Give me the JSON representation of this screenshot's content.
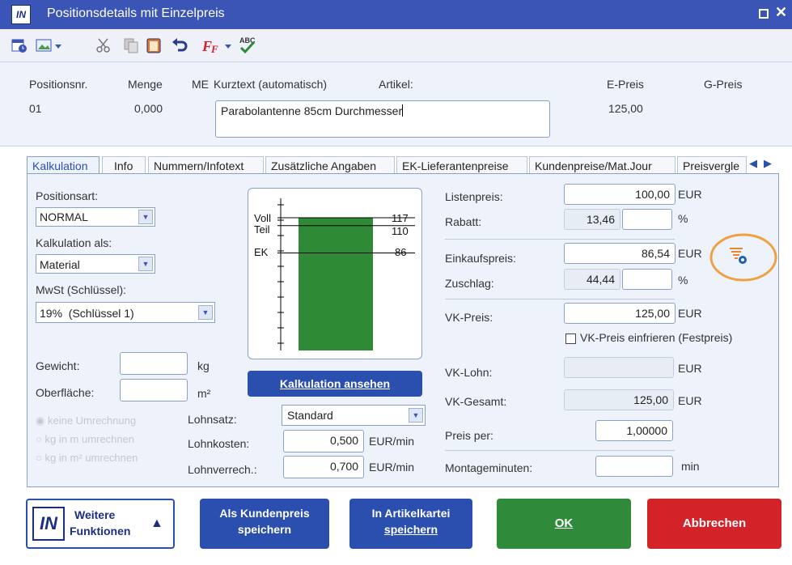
{
  "window": {
    "title": "Positionsdetails mit Einzelpreis",
    "logo": "IN"
  },
  "colors": {
    "titlebar": "#3a55b5",
    "accent": "#2b4fae",
    "ok": "#2f8a3a",
    "cancel": "#d32328",
    "bar": "#2f8a36",
    "highlight_circle": "#f0a040"
  },
  "toolbar": {
    "icons": [
      "calendar-clock-icon",
      "image-dropdown-icon",
      "cut-icon",
      "copy-icon",
      "paste-icon",
      "undo-icon",
      "font-dropdown-icon",
      "spellcheck-icon"
    ]
  },
  "header": {
    "col_posnr": "Positionsnr.",
    "col_menge": "Menge",
    "col_me": "ME",
    "col_kurztext": "Kurztext (automatisch)",
    "col_artikel": "Artikel:",
    "col_epreis": "E-Preis",
    "col_gpreis": "G-Preis",
    "posnr": "01",
    "menge": "0,000",
    "kurztext": "Parabolantenne 85cm Durchmesser",
    "epreis": "125,00"
  },
  "tabs": [
    "Kalkulation",
    "Info",
    "Nummern/Infotext",
    "Zusätzliche Angaben",
    "EK-Lieferantenpreise",
    "Kundenpreise/Mat.Jour",
    "Preisvergle"
  ],
  "left": {
    "positionsart_label": "Positionsart:",
    "positionsart_value": "NORMAL",
    "kalkulation_als_label": "Kalkulation als:",
    "kalkulation_als_value": "Material",
    "mwst_label": "MwSt (Schlüssel):",
    "mwst_value": "19%  (Schlüssel 1)",
    "gewicht_label": "Gewicht:",
    "gewicht_unit": "kg",
    "oberflaeche_label": "Oberfläche:",
    "oberflaeche_unit": "m²",
    "radio_1": "keine Umrechnung",
    "radio_2": "kg in m umrechnen",
    "radio_3": "kg in m² umrechnen"
  },
  "chart": {
    "label_voll": "Voll",
    "label_teil": "Teil",
    "label_ek": "EK",
    "value_voll": "117",
    "value_teil": "110",
    "value_ek": "86"
  },
  "chart_data": {
    "type": "bar",
    "categories": [
      "Voll",
      "Teil",
      "EK"
    ],
    "values": [
      117,
      110,
      86
    ],
    "title": "",
    "xlabel": "",
    "ylabel": ""
  },
  "middle": {
    "kalkulation_button": "Kalkulation ansehen",
    "lohnsatz_label": "Lohnsatz:",
    "lohnsatz_value": "Standard",
    "lohnkosten_label": "Lohnkosten:",
    "lohnkosten_value": "0,500",
    "lohnkosten_unit": "EUR/min",
    "lohnverrech_label": "Lohnverrech.:",
    "lohnverrech_value": "0,700",
    "lohnverrech_unit": "EUR/min"
  },
  "right": {
    "listenpreis_label": "Listenpreis:",
    "listenpreis_value": "100,00",
    "listenpreis_unit": "EUR",
    "rabatt_label": "Rabatt:",
    "rabatt_value": "13,46",
    "rabatt_unit": "%",
    "einkaufspreis_label": "Einkaufspreis:",
    "einkaufspreis_value": "86,54",
    "einkaufspreis_unit": "EUR",
    "zuschlag_label": "Zuschlag:",
    "zuschlag_value": "44,44",
    "zuschlag_unit": "%",
    "vkpreis_label": "VK-Preis:",
    "vkpreis_value": "125,00",
    "vkpreis_unit": "EUR",
    "einfrieren_label": "VK-Preis einfrieren (Festpreis)",
    "vklohn_label": "VK-Lohn:",
    "vklohn_unit": "EUR",
    "vkgesamt_label": "VK-Gesamt:",
    "vkgesamt_value": "125,00",
    "vkgesamt_unit": "EUR",
    "preisper_label": "Preis per:",
    "preisper_value": "1,00000",
    "montage_label": "Montageminuten:",
    "montage_unit": "min"
  },
  "footer": {
    "weitere_line1": "Weitere",
    "weitere_line2": "Funktionen",
    "kundenpreis_line1": "Als Kundenpreis",
    "kundenpreis_line2": "speichern",
    "artikelkartei_line1": "In Artikelkartei",
    "artikelkartei_line2": "speichern",
    "ok": "OK",
    "abbrechen": "Abbrechen"
  }
}
